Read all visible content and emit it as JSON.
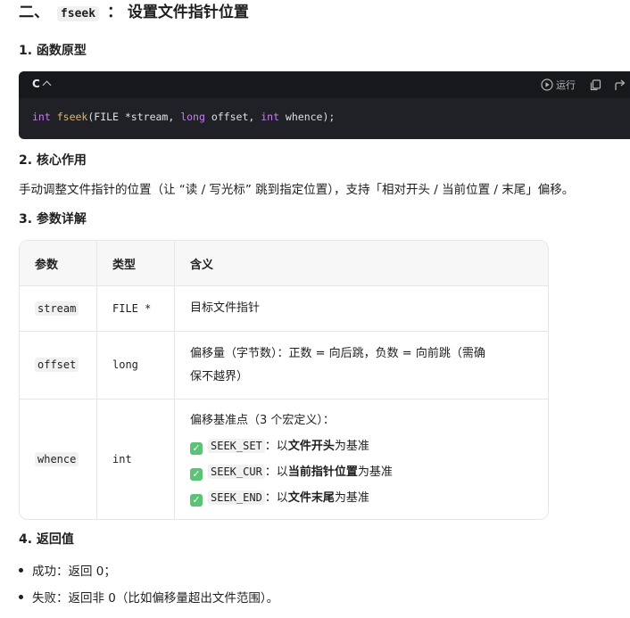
{
  "section_title": {
    "prefix": "二、",
    "code": "fseek",
    "suffix": "： 设置文件指针位置"
  },
  "h1": "1. 函数原型",
  "code_block": {
    "language": "C",
    "run_label": "运行",
    "tokens": {
      "t1": "int",
      "t2": "fseek",
      "t3": "(FILE *stream, ",
      "t4": "long",
      "t5": " offset, ",
      "t6": "int",
      "t7": " whence);"
    }
  },
  "h2": "2. 核心作用",
  "purpose": "手动调整文件指针的位置（让 “读 / 写光标” 跳到指定位置），支持「相对开头 / 当前位置 / 末尾」偏移。",
  "h3": "3. 参数详解",
  "table": {
    "headers": [
      "参数",
      "类型",
      "含义"
    ],
    "rows": [
      {
        "param": "stream",
        "type": "FILE *",
        "desc": "目标文件指针"
      },
      {
        "param": "offset",
        "type": "long",
        "desc_l1": "偏移量（字节数）：正数 = 向后跳，负数 = 向前跳（需确",
        "desc_l2": "保不越界）"
      },
      {
        "param": "whence",
        "type": "int",
        "desc_title": "偏移基准点（3 个宏定义）：",
        "items": [
          {
            "code": "SEEK_SET",
            "sep": "：以",
            "bold": "文件开头",
            "tail": "为基准"
          },
          {
            "code": "SEEK_CUR",
            "sep": "：以",
            "bold": "当前指针位置",
            "tail": "为基准"
          },
          {
            "code": "SEEK_END",
            "sep": "：以",
            "bold": "文件末尾",
            "tail": "为基准"
          }
        ]
      }
    ]
  },
  "h4": "4. 返回值",
  "returns": [
    "成功：返回 0；",
    "失败：返回非 0（比如偏移量超出文件范围）。"
  ],
  "colors": {
    "code_bg": "#1f2126",
    "keyword": "#c67ef0",
    "function": "#e6b365",
    "check": "#5cc278"
  },
  "icons": [
    "chevron-up-icon",
    "run-icon",
    "copy-icon",
    "redo-icon",
    "check-icon"
  ]
}
